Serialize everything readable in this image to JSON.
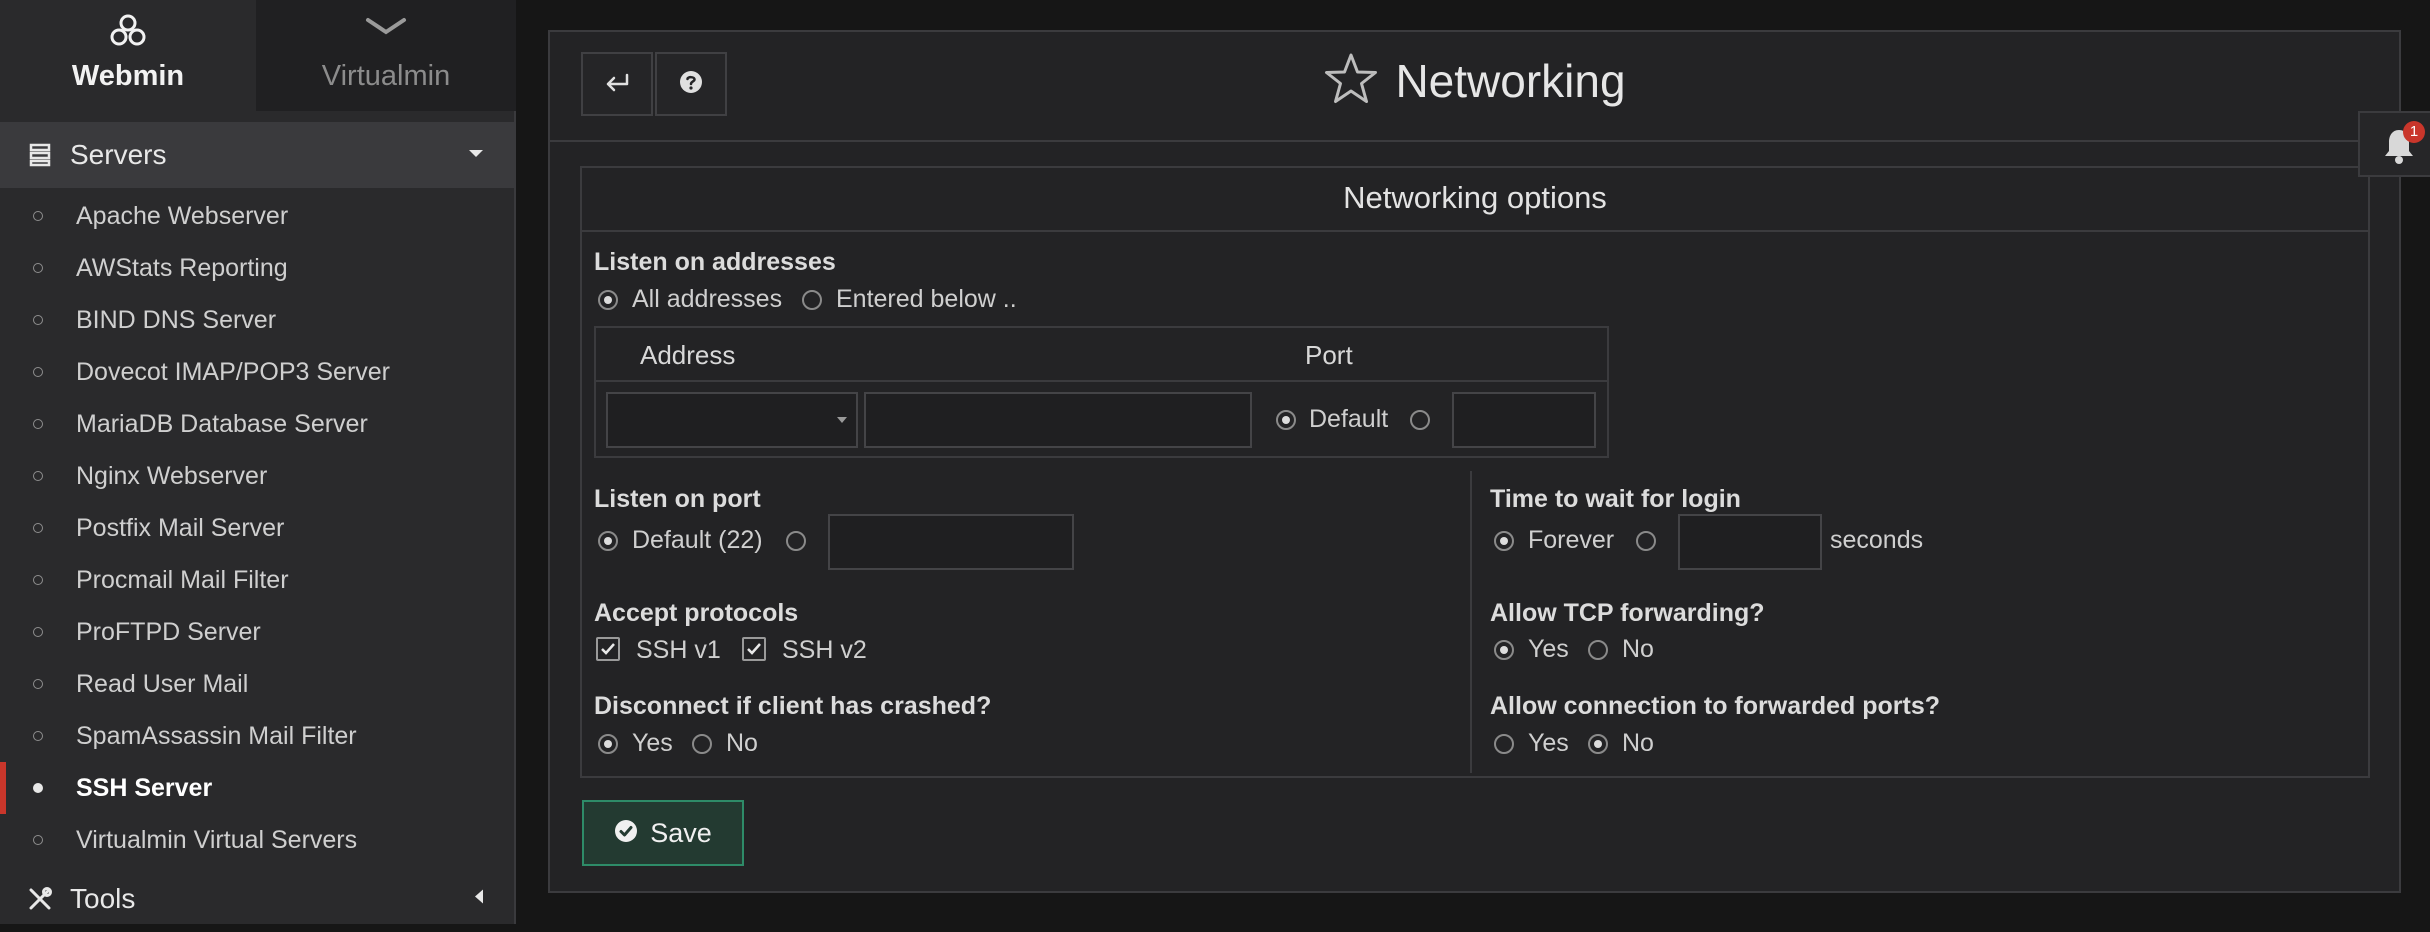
{
  "switcher": {
    "webmin_label": "Webmin",
    "virtualmin_label": "Virtualmin"
  },
  "sidebar": {
    "category": "Servers",
    "items": [
      {
        "label": "Apache Webserver"
      },
      {
        "label": "AWStats Reporting"
      },
      {
        "label": "BIND DNS Server"
      },
      {
        "label": "Dovecot IMAP/POP3 Server"
      },
      {
        "label": "MariaDB Database Server"
      },
      {
        "label": "Nginx Webserver"
      },
      {
        "label": "Postfix Mail Server"
      },
      {
        "label": "Procmail Mail Filter"
      },
      {
        "label": "ProFTPD Server"
      },
      {
        "label": "Read User Mail"
      },
      {
        "label": "SpamAssassin Mail Filter"
      },
      {
        "label": "SSH Server",
        "active": true
      },
      {
        "label": "Virtualmin Virtual Servers"
      }
    ],
    "tools_label": "Tools"
  },
  "header": {
    "title": "Networking"
  },
  "section": {
    "title": "Networking options"
  },
  "listen_addresses": {
    "label": "Listen on addresses",
    "option_all": "All addresses",
    "option_below": "Entered below ..",
    "selected": "all",
    "table": {
      "col_address": "Address",
      "col_port": "Port",
      "address_value": "",
      "port_default_label": "Default",
      "port_selected": "default",
      "port_value": ""
    }
  },
  "listen_port": {
    "label": "Listen on port",
    "option_default": "Default (22)",
    "selected": "default",
    "value": ""
  },
  "protocols": {
    "label": "Accept protocols",
    "ssh_v1": "SSH v1",
    "ssh_v1_checked": true,
    "ssh_v2": "SSH v2",
    "ssh_v2_checked": true
  },
  "disconnect": {
    "label": "Disconnect if client has crashed?",
    "yes": "Yes",
    "no": "No",
    "selected": "yes"
  },
  "login_wait": {
    "label": "Time to wait for login",
    "option_forever": "Forever",
    "selected": "forever",
    "value": "",
    "unit": "seconds"
  },
  "tcp_forwarding": {
    "label": "Allow TCP forwarding?",
    "yes": "Yes",
    "no": "No",
    "selected": "yes"
  },
  "forwarded_ports": {
    "label": "Allow connection to forwarded ports?",
    "yes": "Yes",
    "no": "No",
    "selected": "no"
  },
  "actions": {
    "save_label": "Save"
  },
  "notifications": {
    "count": "1"
  },
  "colors": {
    "accent_active": "#c9362b",
    "save_border": "#2e8b68",
    "badge": "#c9362b"
  }
}
